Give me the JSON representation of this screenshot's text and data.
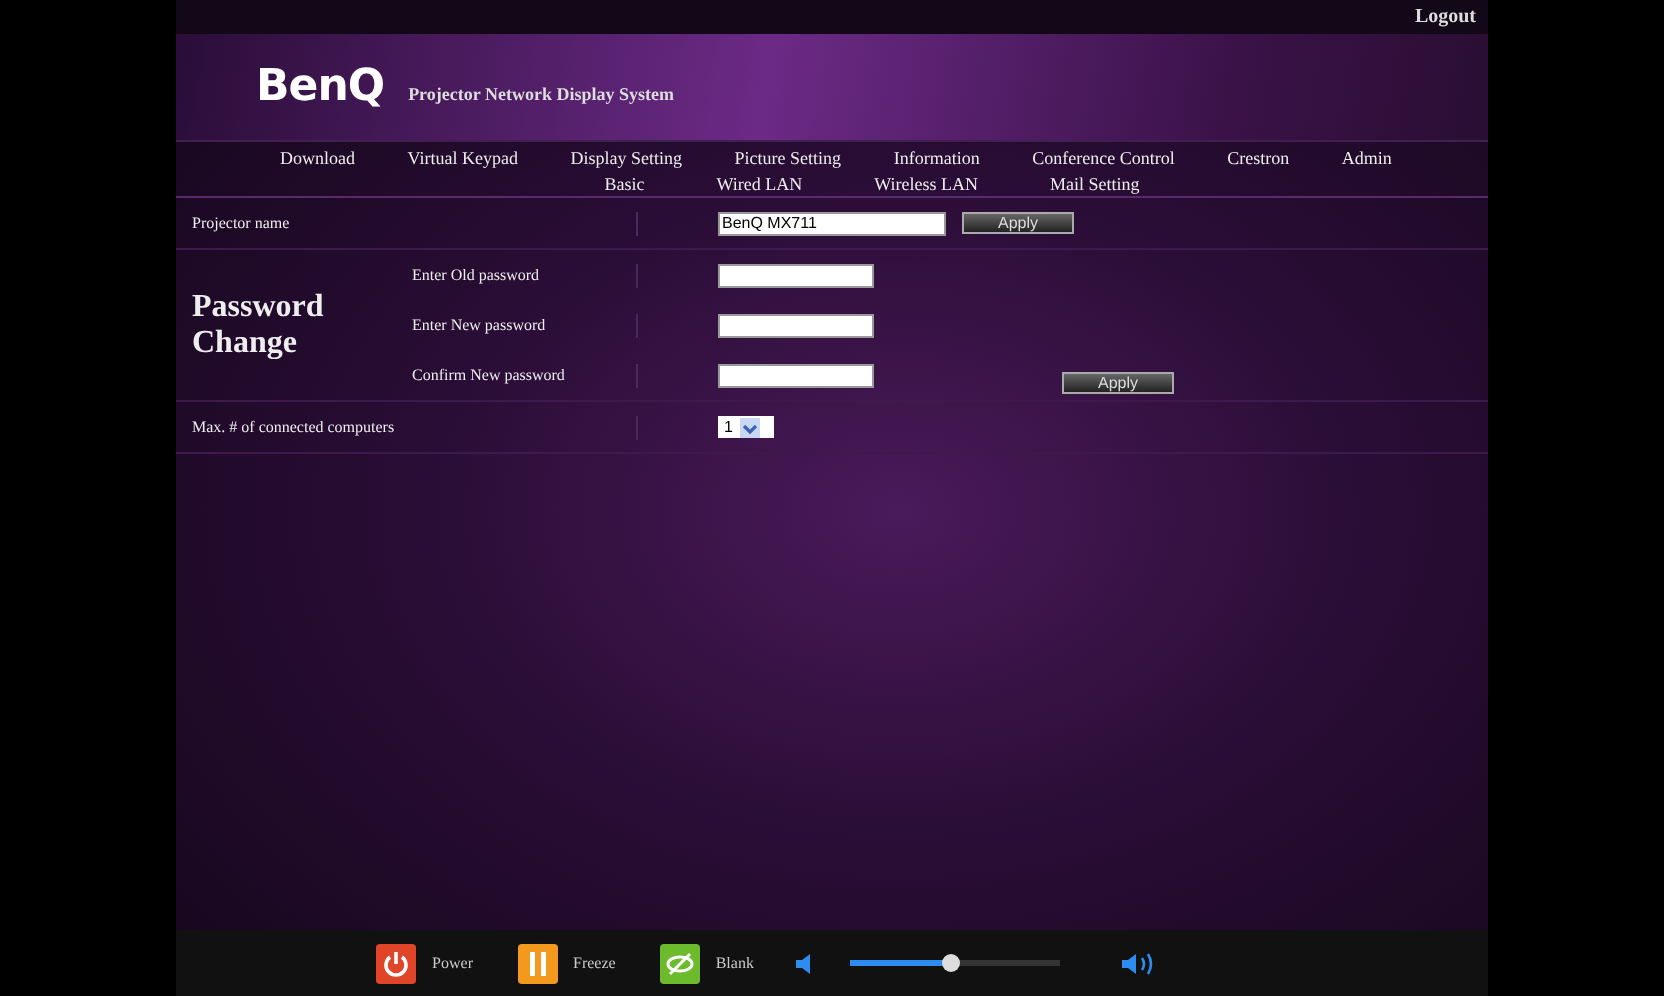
{
  "top_bar": {
    "logout": "Logout"
  },
  "header": {
    "logo": "BenQ",
    "title": "Projector Network Display System"
  },
  "main_nav": [
    "Download",
    "Virtual Keypad",
    "Display Setting",
    "Picture Setting",
    "Information",
    "Conference Control",
    "Crestron",
    "Admin"
  ],
  "sub_nav": [
    "Basic",
    "Wired LAN",
    "Wireless LAN",
    "Mail Setting"
  ],
  "projector_name": {
    "label": "Projector name",
    "value": "BenQ MX711",
    "button": "Apply"
  },
  "password_change": {
    "label": "Password Change",
    "fields": [
      {
        "label": "Enter Old password"
      },
      {
        "label": "Enter New password"
      },
      {
        "label": "Confirm New password"
      }
    ],
    "button": "Apply"
  },
  "max_connections": {
    "label": "Max. # of connected computers",
    "value": "1"
  },
  "bottom_bar": {
    "buttons": [
      {
        "kind": "power",
        "label": "Power"
      },
      {
        "kind": "freeze",
        "label": "Freeze"
      },
      {
        "kind": "blank",
        "label": "Blank"
      }
    ],
    "volume": {
      "level": 0.49
    }
  }
}
